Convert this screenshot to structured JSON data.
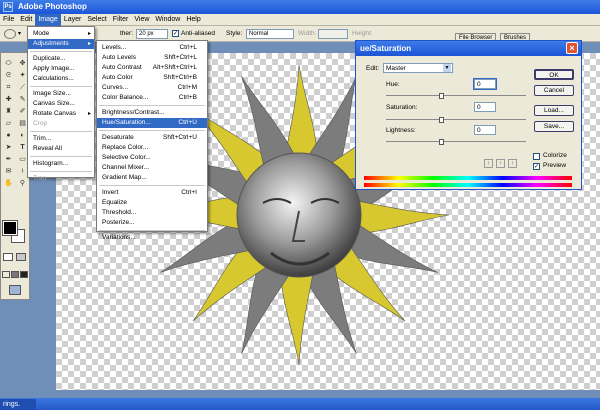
{
  "app": {
    "title": "Adobe Photoshop"
  },
  "menubar": {
    "items": [
      "File",
      "Edit",
      "Image",
      "Layer",
      "Select",
      "Filter",
      "View",
      "Window",
      "Help"
    ],
    "active_index": 2
  },
  "options": {
    "feather_label": "ther:",
    "feather_value": "20 px",
    "antialiased_label": "Anti-aliased",
    "style_label": "Style:",
    "style_value": "Normal",
    "width_label": "Width:",
    "height_label": "Height:"
  },
  "palette_tabs": [
    "File Browser",
    "Brushes"
  ],
  "image_menu": {
    "items": [
      {
        "label": "Mode",
        "submenu": true
      },
      {
        "label": "Adjustments",
        "submenu": true,
        "highlighted": true
      },
      {
        "label": "Duplicate..."
      },
      {
        "label": "Apply Image..."
      },
      {
        "label": "Calculations..."
      },
      {
        "label": "Image Size..."
      },
      {
        "label": "Canvas Size..."
      },
      {
        "label": "Rotate Canvas",
        "submenu": true
      },
      {
        "label": "Crop",
        "disabled": true
      },
      {
        "label": "Trim..."
      },
      {
        "label": "Reveal All"
      },
      {
        "label": "Histogram..."
      },
      {
        "label": "Trap...",
        "disabled": true
      }
    ]
  },
  "adjust_menu": {
    "items": [
      {
        "label": "Levels...",
        "shortcut": "Ctrl+L"
      },
      {
        "label": "Auto Levels",
        "shortcut": "Shft+Ctrl+L"
      },
      {
        "label": "Auto Contrast",
        "shortcut": "Alt+Shft+Ctrl+L"
      },
      {
        "label": "Auto Color",
        "shortcut": "Shft+Ctrl+B"
      },
      {
        "label": "Curves...",
        "shortcut": "Ctrl+M"
      },
      {
        "label": "Color Balance...",
        "shortcut": "Ctrl+B"
      },
      {
        "label": "Brightness/Contrast..."
      },
      {
        "label": "Hue/Saturation...",
        "shortcut": "Ctrl+U",
        "highlighted": true
      },
      {
        "label": "Desaturate",
        "shortcut": "Shft+Ctrl+U"
      },
      {
        "label": "Replace Color..."
      },
      {
        "label": "Selective Color..."
      },
      {
        "label": "Channel Mixer..."
      },
      {
        "label": "Gradient Map..."
      },
      {
        "label": "Invert",
        "shortcut": "Ctrl+I"
      },
      {
        "label": "Equalize"
      },
      {
        "label": "Threshold..."
      },
      {
        "label": "Posterize..."
      },
      {
        "label": "Variations..."
      }
    ]
  },
  "dialog": {
    "title": "ue/Saturation",
    "edit_label": "Edit:",
    "edit_value": "Master",
    "hue_label": "Hue:",
    "hue_value": "0",
    "saturation_label": "Saturation:",
    "saturation_value": "0",
    "lightness_label": "Lightness:",
    "lightness_value": "0",
    "ok_label": "OK",
    "cancel_label": "Cancel",
    "load_label": "Load...",
    "save_label": "Save...",
    "colorize_label": "Colorize",
    "colorize_checked": false,
    "preview_label": "Preview",
    "preview_checked": true
  },
  "taskbar": {
    "item": "rings."
  },
  "colors": {
    "titlebar": "#1d55d8",
    "menu_highlight": "#316ac5",
    "sun_yellow": "#d7c830",
    "sun_grey": "#7c7c7c"
  }
}
